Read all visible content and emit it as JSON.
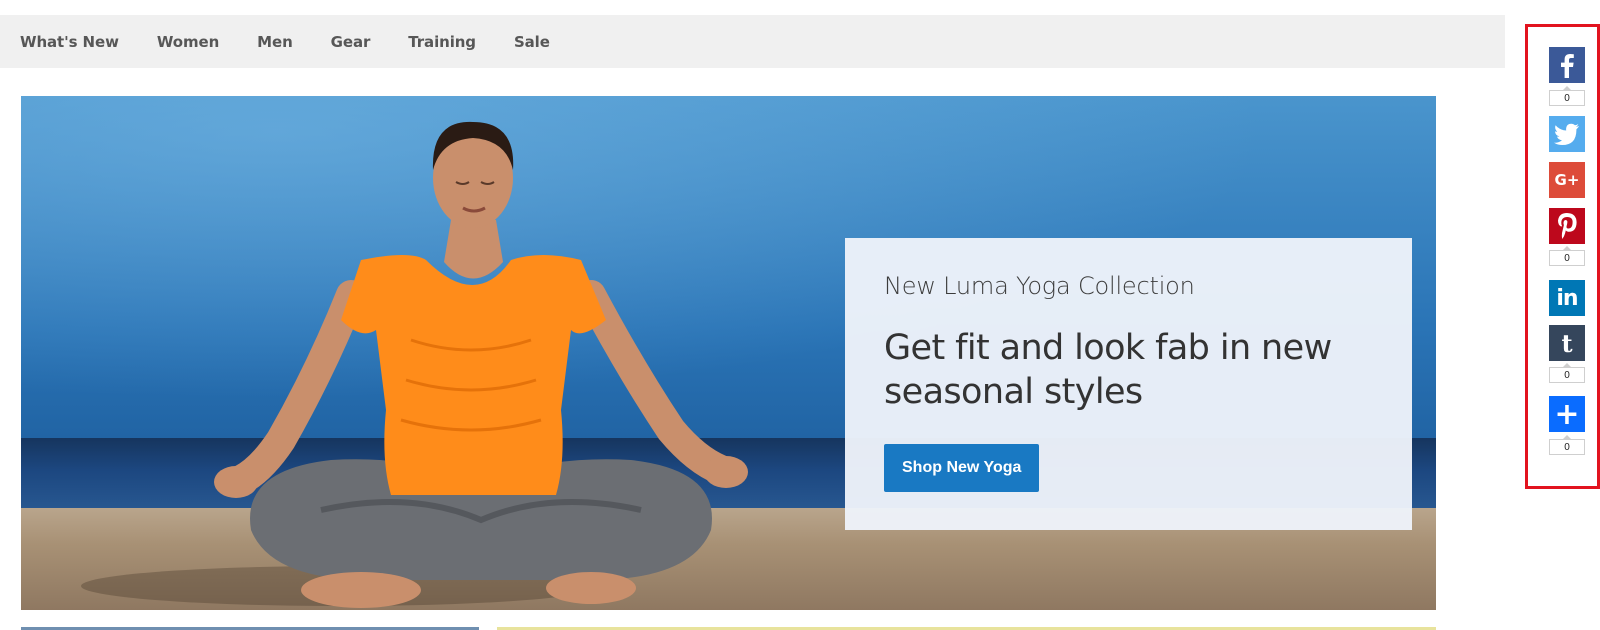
{
  "nav": {
    "items": [
      {
        "label": "What's New"
      },
      {
        "label": "Women"
      },
      {
        "label": "Men"
      },
      {
        "label": "Gear"
      },
      {
        "label": "Training"
      },
      {
        "label": "Sale"
      }
    ]
  },
  "hero": {
    "kicker": "New Luma Yoga Collection",
    "headline": "Get fit and look fab in new seasonal styles",
    "button_label": "Shop New Yoga"
  },
  "share": {
    "buttons": [
      {
        "name": "facebook",
        "icon": "facebook-icon",
        "color": "#3b5998",
        "glyph": "f",
        "count": "0"
      },
      {
        "name": "twitter",
        "icon": "twitter-icon",
        "color": "#55acee",
        "count": null
      },
      {
        "name": "google-plus",
        "icon": "google-plus-icon",
        "color": "#dd4b39",
        "glyph": "G+",
        "count": null
      },
      {
        "name": "pinterest",
        "icon": "pinterest-icon",
        "color": "#bd081c",
        "glyph": "P",
        "count": "0"
      },
      {
        "name": "linkedin",
        "icon": "linkedin-icon",
        "color": "#0077b5",
        "glyph": "in",
        "count": null
      },
      {
        "name": "tumblr",
        "icon": "tumblr-icon",
        "color": "#35465c",
        "glyph": "t",
        "count": "0"
      },
      {
        "name": "addthis",
        "icon": "plus-icon",
        "color": "#0a6cff",
        "glyph": "+",
        "count": "0"
      }
    ]
  },
  "colors": {
    "accent": "#1979c3",
    "nav_background": "#f0f0f0",
    "highlight_frame": "#e2131f"
  }
}
